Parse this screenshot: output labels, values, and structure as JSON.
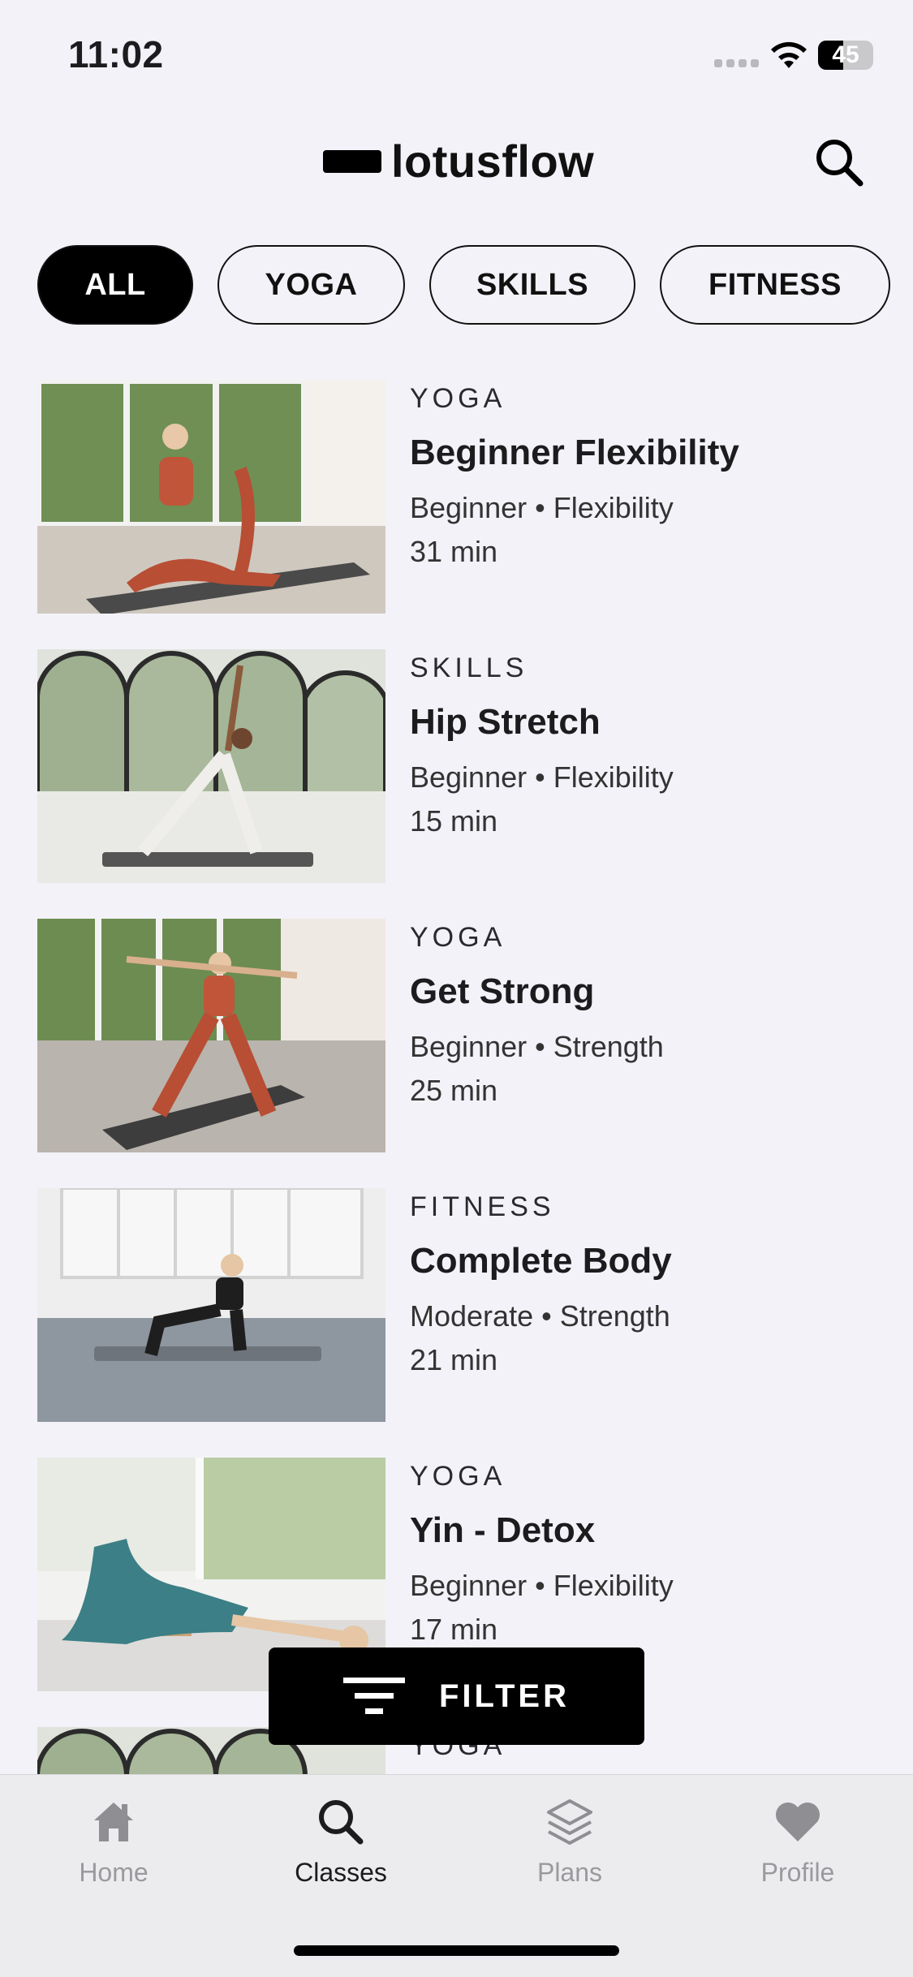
{
  "status_bar": {
    "time": "11:02",
    "battery": "45",
    "battery_level": 0.45
  },
  "header": {
    "logo_text": "lotusflow",
    "search_icon": "search-icon"
  },
  "chips": [
    {
      "label": "ALL",
      "active": true
    },
    {
      "label": "YOGA",
      "active": false
    },
    {
      "label": "SKILLS",
      "active": false
    },
    {
      "label": "FITNESS",
      "active": false
    }
  ],
  "classes": [
    {
      "category": "YOGA",
      "title": "Beginner Flexibility",
      "level": "Beginner",
      "focus": "Flexibility",
      "duration": "31 min"
    },
    {
      "category": "SKILLS",
      "title": "Hip Stretch",
      "level": "Beginner",
      "focus": "Flexibility",
      "duration": "15 min"
    },
    {
      "category": "YOGA",
      "title": "Get Strong",
      "level": "Beginner",
      "focus": "Strength",
      "duration": "25 min"
    },
    {
      "category": "FITNESS",
      "title": "Complete Body",
      "level": "Moderate",
      "focus": "Strength",
      "duration": "21 min"
    },
    {
      "category": "YOGA",
      "title": "Yin - Detox",
      "level": "Beginner",
      "focus": "Flexibility",
      "duration": "17 min"
    },
    {
      "category": "YOGA",
      "title": "",
      "level": "",
      "focus": "",
      "duration": ""
    }
  ],
  "meta_separator": "•",
  "filter": {
    "label": "FILTER",
    "icon": "filter-icon"
  },
  "tabs": [
    {
      "label": "Home",
      "icon": "house-icon",
      "active": false
    },
    {
      "label": "Classes",
      "icon": "search-icon",
      "active": true
    },
    {
      "label": "Plans",
      "icon": "layers-icon",
      "active": false
    },
    {
      "label": "Profile",
      "icon": "heart-icon",
      "active": false
    }
  ],
  "colors": {
    "background": "#f3f2f8",
    "accent": "#000000",
    "inactive": "#9a9a9e"
  }
}
